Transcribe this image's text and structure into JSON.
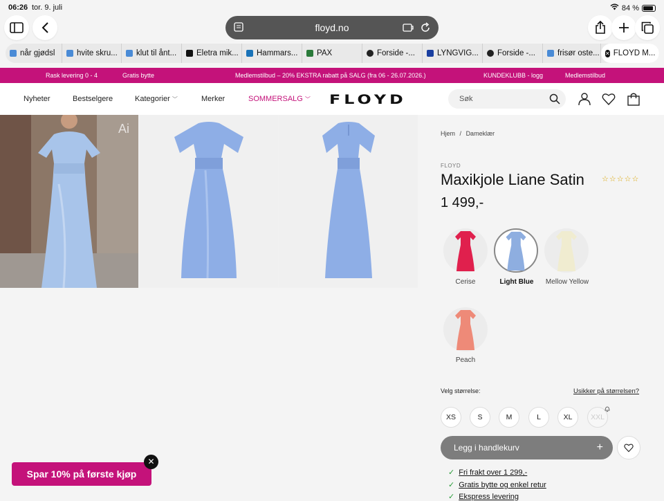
{
  "status": {
    "time": "06:26",
    "date": "tor. 9. juli",
    "battery": "84 %",
    "battery_level": 0.84
  },
  "browser": {
    "url": "floyd.no",
    "tabs": [
      {
        "label": "når gjødsl",
        "color": "#4a8bd6"
      },
      {
        "label": "hvite skru...",
        "color": "#4a8bd6"
      },
      {
        "label": "klut til ånt...",
        "color": "#4a8bd6"
      },
      {
        "label": "Eletra mik...",
        "color": "#111111"
      },
      {
        "label": "Hammars...",
        "color": "#1a73b8"
      },
      {
        "label": "PAX",
        "color": "#2a7a3a"
      },
      {
        "label": "Forside -...",
        "color": "#222222"
      },
      {
        "label": "LYNGVIG...",
        "color": "#1a3fa0"
      },
      {
        "label": "Forside -...",
        "color": "#222222"
      },
      {
        "label": "frisør oste...",
        "color": "#4a8bd6"
      },
      {
        "label": "FLOYD M...",
        "color": "#111111",
        "active": true
      }
    ]
  },
  "promo": {
    "delivery": "Rask levering 0 - 4",
    "exchange": "Gratis bytte",
    "offer": "Medlemstilbud  –  20% EKSTRA rabatt på SALG (fra 06 - 26.07.2026.)",
    "club": "KUNDEKLUBB - logg",
    "members": "Medlemstilbud"
  },
  "nav": {
    "items": [
      "Nyheter",
      "Bestselgere",
      "Kategorier",
      "Merker"
    ],
    "sale": "SOMMERSALG",
    "logo": "FLOYD",
    "search_placeholder": "Søk"
  },
  "gallery": {
    "ai_badge": "Ai"
  },
  "product": {
    "breadcrumb_home": "Hjem",
    "breadcrumb_sep": "/",
    "breadcrumb_cat": "Dameklær",
    "brand": "FLOYD",
    "title": "Maxikjole Liane Satin",
    "price": "1 499,-",
    "rating_stars": "☆☆☆☆☆",
    "rating": 0,
    "colors": [
      {
        "name": "Cerise",
        "hex": "#e0204d"
      },
      {
        "name": "Light Blue",
        "hex": "#8eaee0",
        "selected": true
      },
      {
        "name": "Mellow Yellow",
        "hex": "#f0ecd0"
      },
      {
        "name": "Peach",
        "hex": "#ee8a78"
      }
    ],
    "size_label": "Velg størrelse:",
    "size_help": "Usikker på størrelsen?",
    "sizes": [
      "XS",
      "S",
      "M",
      "L",
      "XL",
      "XXL"
    ],
    "unavailable_size": "XXL",
    "add_to_cart": "Legg i handlekurv",
    "usps": [
      "Fri frakt over 1 299,-",
      "Gratis bytte og enkel retur",
      "Ekspress levering"
    ]
  },
  "popup": {
    "label": "Spar 10% på første kjøp"
  }
}
